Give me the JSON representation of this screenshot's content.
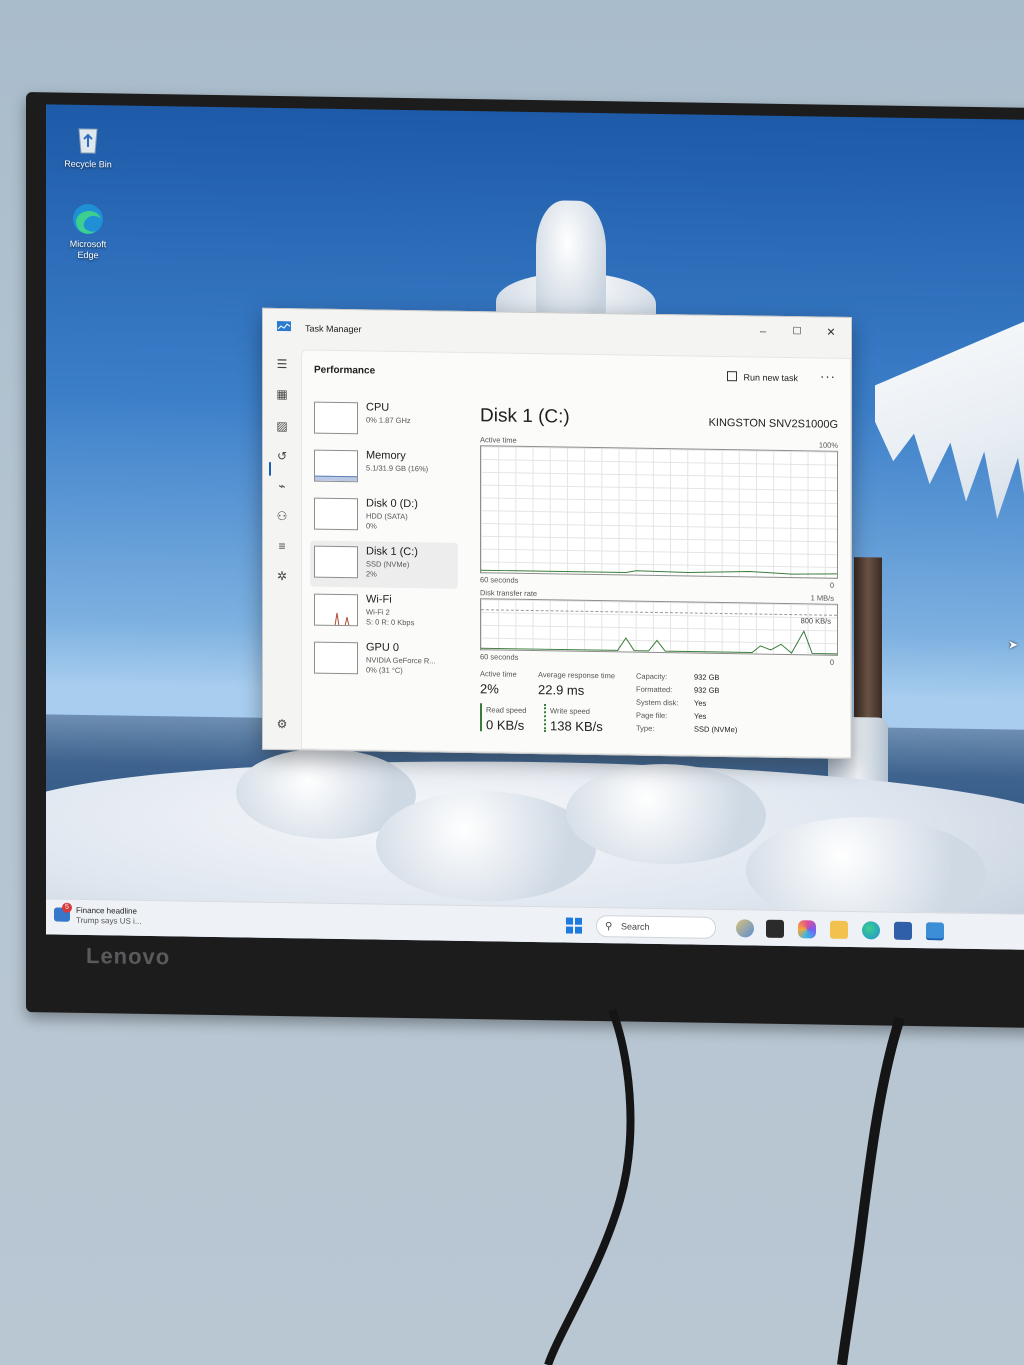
{
  "desktop": {
    "icons": [
      {
        "label": "Recycle Bin"
      },
      {
        "label": "Microsoft Edge"
      }
    ]
  },
  "monitor": {
    "brand": "Lenovo"
  },
  "task_manager": {
    "window_title": "Task Manager",
    "window_controls": {
      "minimize": "–",
      "maximize": "☐",
      "close": "✕"
    },
    "page_title": "Performance",
    "run_new_task_label": "Run new task",
    "more_label": "···",
    "devices": [
      {
        "name": "CPU",
        "line1": "0%  1.87 GHz",
        "line2": ""
      },
      {
        "name": "Memory",
        "line1": "5.1/31.9 GB (16%)",
        "line2": ""
      },
      {
        "name": "Disk 0 (D:)",
        "line1": "HDD (SATA)",
        "line2": "0%"
      },
      {
        "name": "Disk 1 (C:)",
        "line1": "SSD (NVMe)",
        "line2": "2%"
      },
      {
        "name": "Wi-Fi",
        "line1": "Wi-Fi 2",
        "line2": "S: 0  R: 0 Kbps"
      },
      {
        "name": "GPU 0",
        "line1": "NVIDIA GeForce R...",
        "line2": "0% (31 °C)"
      }
    ],
    "selected_device": "Disk 1 (C:)",
    "detail": {
      "title": "Disk 1 (C:)",
      "model": "KINGSTON SNV2S1000G",
      "active_time_graph": {
        "label": "Active time",
        "max": "100%",
        "time_span": "60 seconds",
        "min": "0"
      },
      "transfer_graph": {
        "label": "Disk transfer rate",
        "max": "1 MB/s",
        "mid_label": "800 KB/s",
        "time_span": "60 seconds",
        "min": "0"
      },
      "stats": {
        "active_time_label": "Active time",
        "active_time_value": "2%",
        "avg_response_label": "Average response time",
        "avg_response_value": "22.9 ms",
        "read_speed_label": "Read speed",
        "read_speed_value": "0 KB/s",
        "write_speed_label": "Write speed",
        "write_speed_value": "138 KB/s"
      },
      "properties": [
        {
          "label": "Capacity:",
          "value": "932 GB"
        },
        {
          "label": "Formatted:",
          "value": "932 GB"
        },
        {
          "label": "System disk:",
          "value": "Yes"
        },
        {
          "label": "Page file:",
          "value": "Yes"
        },
        {
          "label": "Type:",
          "value": "SSD (NVMe)"
        }
      ]
    }
  },
  "taskbar": {
    "news_title": "Finance headline",
    "news_text": "Trump says US i...",
    "news_badge": "5",
    "search_placeholder": "Search"
  },
  "colors": {
    "accent": "#1a5fb4",
    "graph_line": "#3a7d3a",
    "window_bg": "#f4f4f2"
  }
}
